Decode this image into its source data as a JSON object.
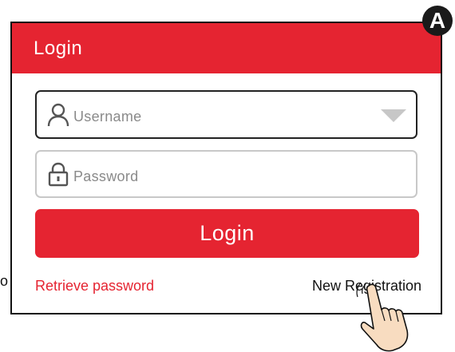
{
  "badge": {
    "label": "A"
  },
  "dialog": {
    "title": "Login",
    "username": {
      "placeholder": "Username",
      "icon": "user-icon",
      "dropdown_icon": "chevron-down-icon"
    },
    "password": {
      "placeholder": "Password",
      "icon": "lock-icon"
    },
    "login_button": "Login",
    "retrieve_link": "Retrieve password",
    "new_registration_link": "New Registration"
  },
  "left_fragment": "o",
  "colors": {
    "accent": "#e52431",
    "border_focused": "#222222",
    "border_default": "#c8c8c8",
    "placeholder": "#8a8a8a"
  }
}
